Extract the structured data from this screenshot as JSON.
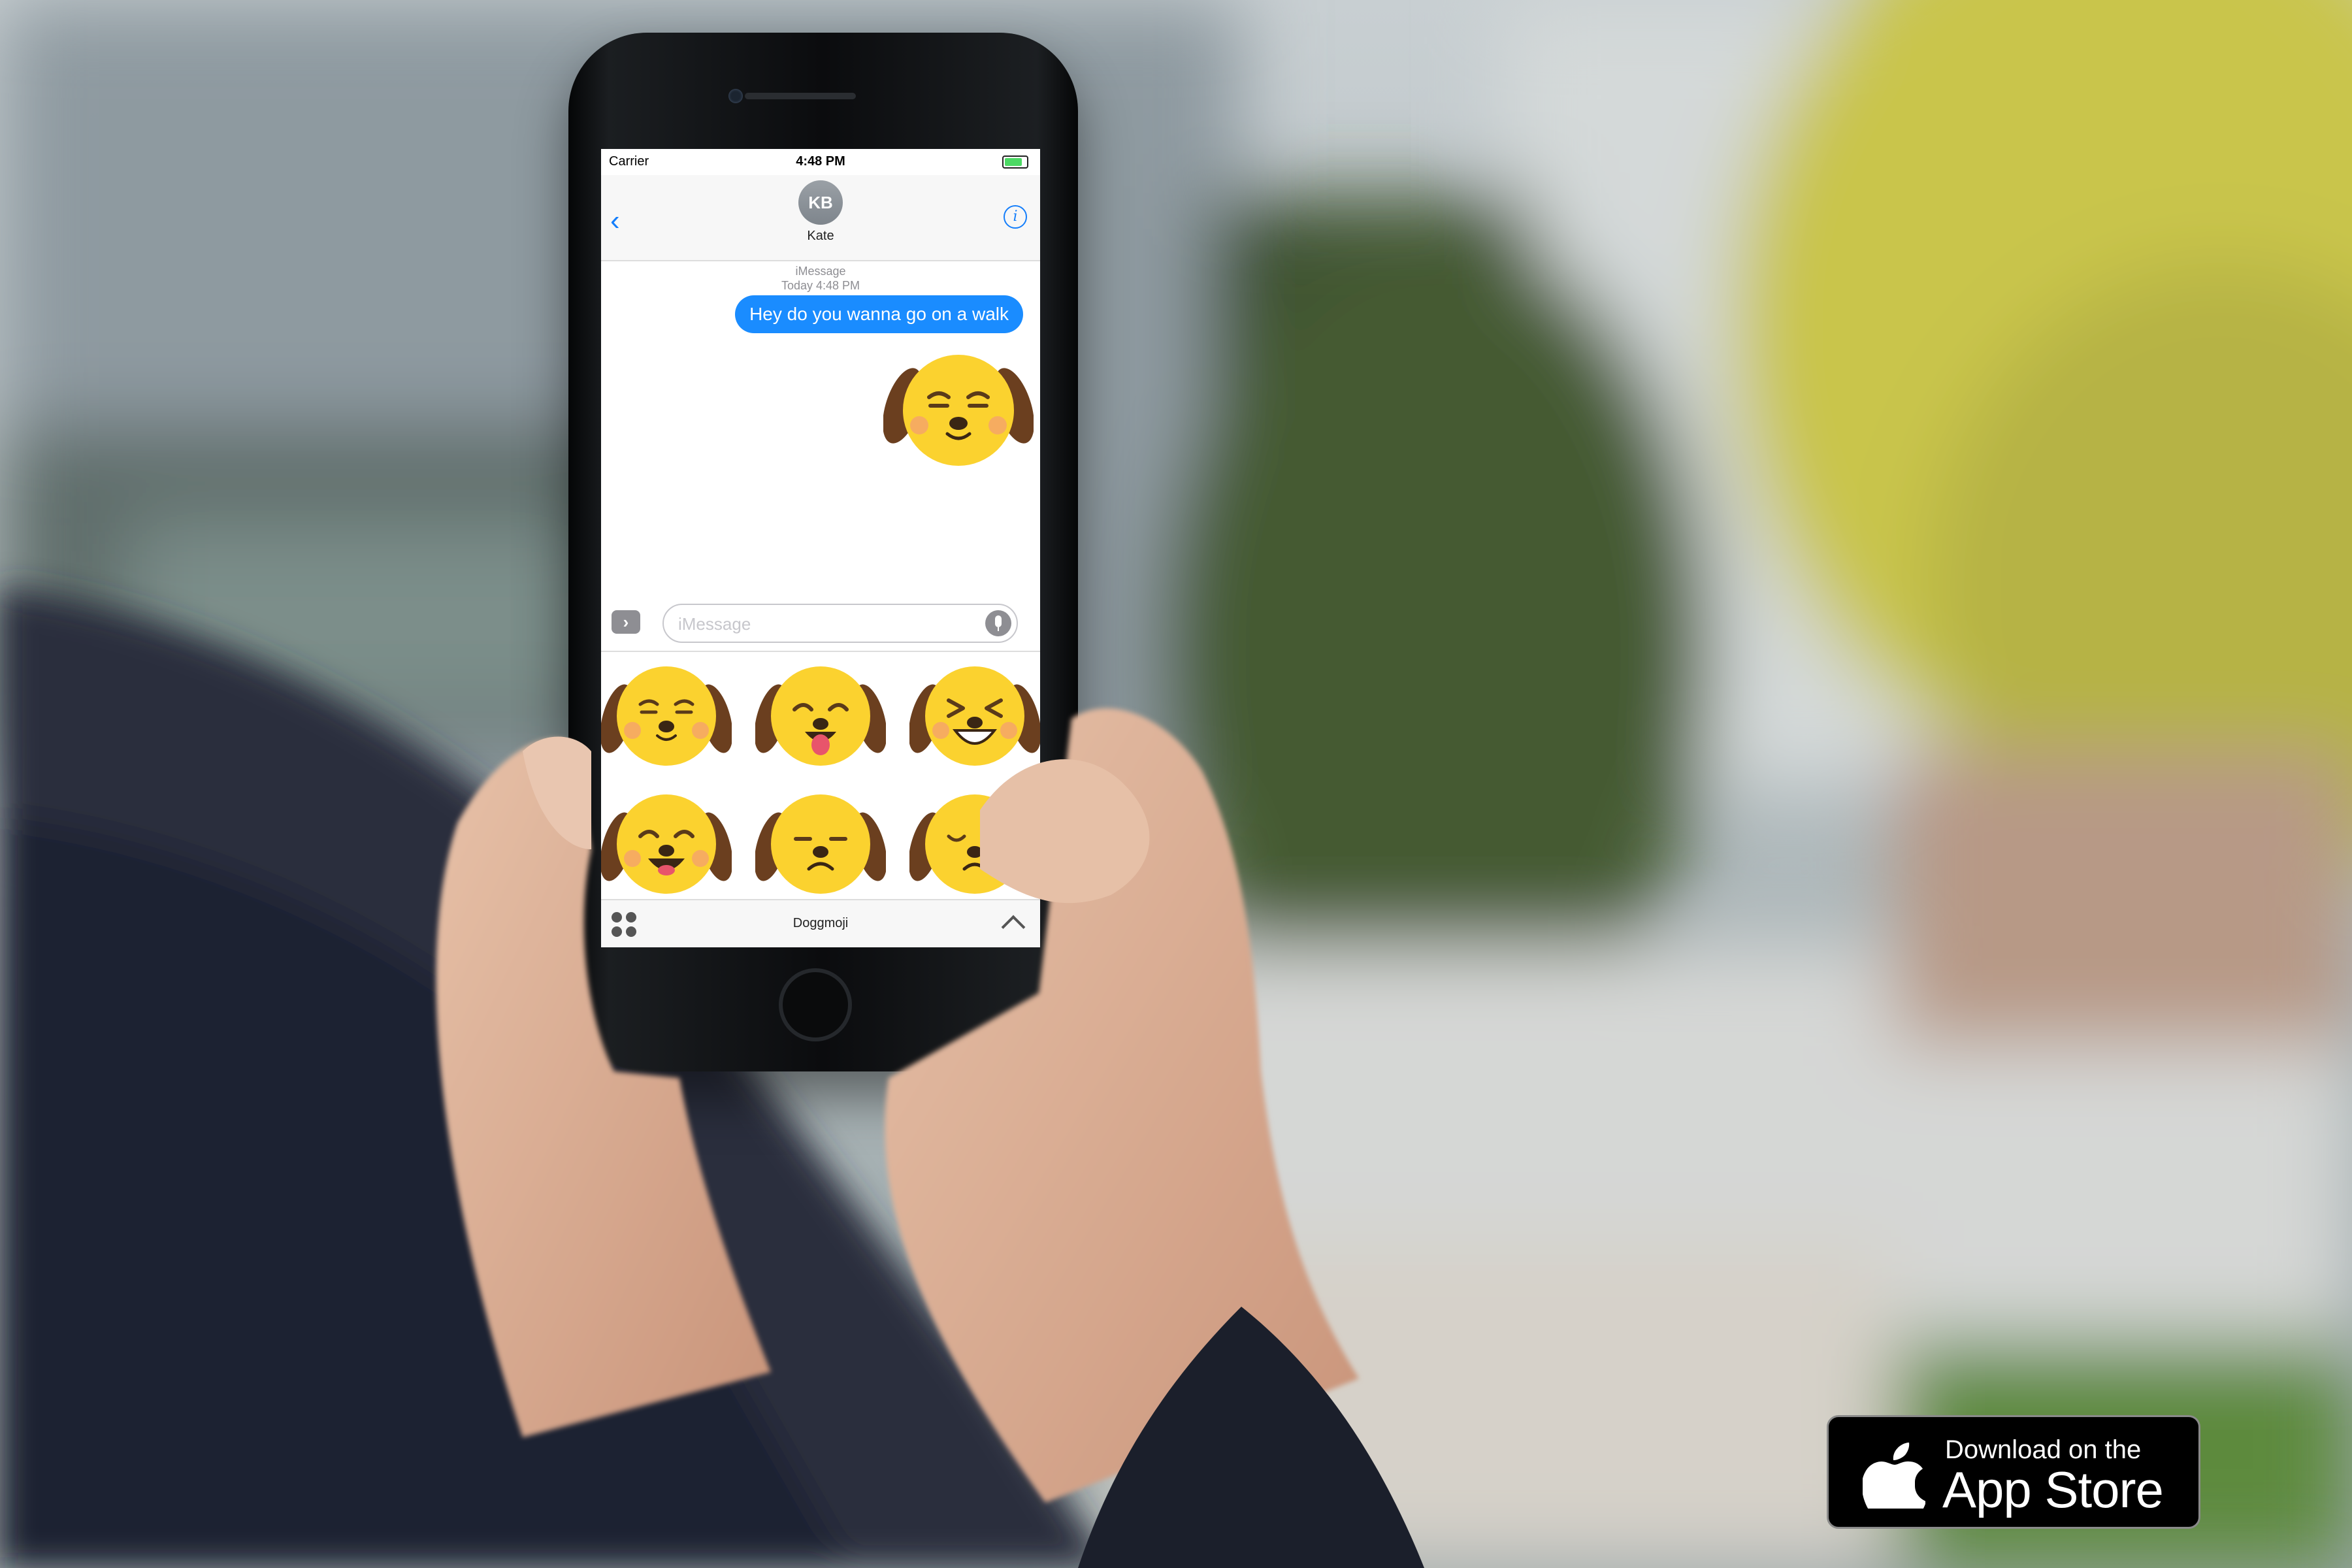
{
  "status_bar": {
    "carrier": "Carrier",
    "time": "4:48 PM"
  },
  "header": {
    "avatar_initials": "KB",
    "contact_name": "Kate"
  },
  "conversation": {
    "service": "iMessage",
    "timestamp": "Today 4:48 PM",
    "messages": [
      {
        "text": "Hey do you wanna go on a walk",
        "sender": "me"
      }
    ]
  },
  "compose": {
    "placeholder": "iMessage"
  },
  "app_drawer": {
    "app_name": "Doggmoji",
    "stickers": [
      "content-dog",
      "tongue-out-dog",
      "laughing-dog",
      "happy-dog",
      "sad-dog",
      "crying-dog"
    ]
  },
  "badge": {
    "line1": "Download on the",
    "line2": "App Store"
  },
  "colors": {
    "imessage_blue": "#1a8cff",
    "sticker_yellow": "#fbd22f",
    "ear_brown": "#6b3f1f",
    "badge_bg": "#000000"
  }
}
